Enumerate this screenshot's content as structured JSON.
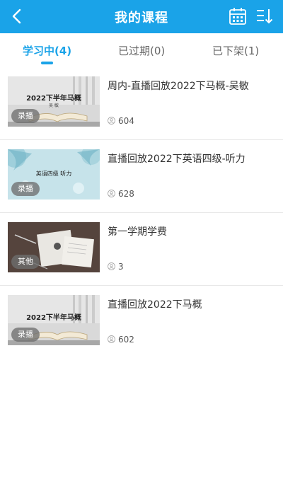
{
  "header": {
    "title": "我的课程",
    "back_icon": "chevron-left-icon",
    "calendar_icon": "calendar-icon",
    "sort_icon": "sort-icon",
    "bg_color": "#1aa3e8"
  },
  "tabs": [
    {
      "label": "学习中(4)",
      "active": true
    },
    {
      "label": "已过期(0)",
      "active": false
    },
    {
      "label": "已下架(1)",
      "active": false
    }
  ],
  "courses": [
    {
      "title": "周内-直播回放2022下马概-吴敏",
      "badge": "录播",
      "count": "604",
      "thumb_title": "2022下半年马概",
      "thumb_sub": "吴  敏"
    },
    {
      "title": "直播回放2022下英语四级-听力",
      "badge": "录播",
      "count": "628",
      "thumb_title": "英语四级 听力"
    },
    {
      "title": "第一学期学费",
      "badge": "其他",
      "count": "3"
    },
    {
      "title": "直播回放2022下马概",
      "badge": "录播",
      "count": "602",
      "thumb_title": "2022下半年马概"
    }
  ]
}
